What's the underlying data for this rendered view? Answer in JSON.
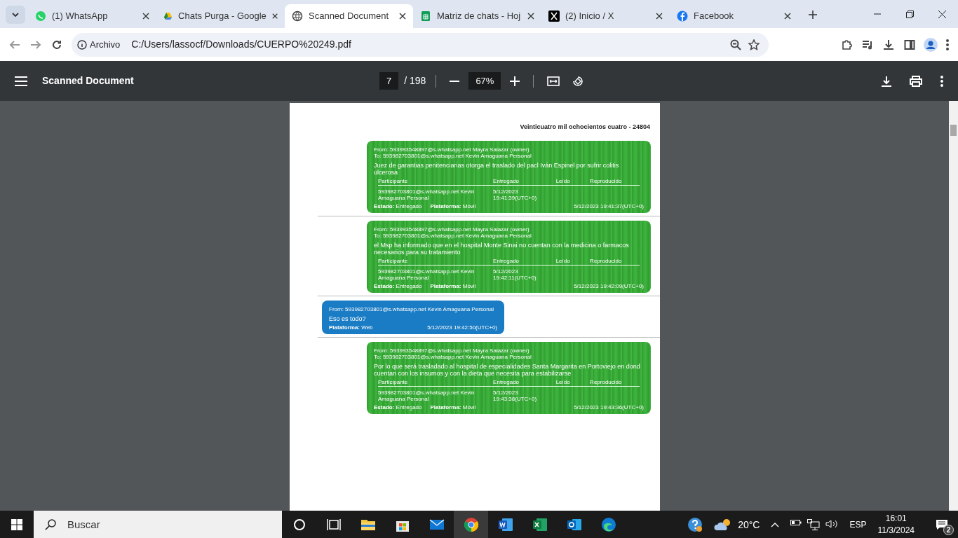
{
  "browser": {
    "tabs": [
      {
        "title": "(1) WhatsApp",
        "selected": false
      },
      {
        "title": "Chats Purga - Google",
        "selected": false
      },
      {
        "title": "Scanned Document",
        "selected": true
      },
      {
        "title": "Matriz de chats - Hoj",
        "selected": false
      },
      {
        "title": "(2) Inicio / X",
        "selected": false
      },
      {
        "title": "Facebook",
        "selected": false
      }
    ],
    "address": {
      "chip": "Archivo",
      "url": "C:/Users/lassocf/Downloads/CUERPO%20249.pdf"
    }
  },
  "pdf_toolbar": {
    "title": "Scanned Document",
    "page": "7",
    "page_total": "/ 198",
    "zoom": "67%"
  },
  "document": {
    "header": "Veinticuatro mil ochocientos cuatro - 24804",
    "messages": [
      {
        "kind": "received",
        "from": "From: 593993548897@s.whatsapp.net Mayra Salazar (owner)",
        "to": "To: 593982703801@s.whatsapp.net Kevin Amaguana Personal",
        "body": "Juez de garantias penitenciarias otorga el traslado del pacl Iván Espinel por sufrir colitis ulcerosa",
        "columns": [
          "Participante",
          "Entregado",
          "Leído",
          "Reproducido"
        ],
        "row": [
          "593982703801@s.whatsapp.net Kevin Amaguana Personal",
          "5/12/2023 19:41:39(UTC+0)"
        ],
        "status": "**Estado:** Entregado",
        "platform": "**Plataforma:** Móvil",
        "timestamp": "5/12/2023 19:41:37(UTC+0)"
      },
      {
        "kind": "received",
        "from": "From: 593993548897@s.whatsapp.net Mayra Salazar (owner)",
        "to": "To: 593982703801@s.whatsapp.net Kevin Amaguana Personal",
        "body": "el Msp ha informado que en el hospital Monte Sinai no cuentan con la medicina o farmacos necesarios para su tratamiento",
        "columns": [
          "Participante",
          "Entregado",
          "Leído",
          "Reproducido"
        ],
        "row": [
          "593982703801@s.whatsapp.net Kevin Amaguana Personal",
          "5/12/2023 19:42:11(UTC+0)"
        ],
        "status": "**Estado:** Entregado",
        "platform": "**Plataforma:** Móvil",
        "timestamp": "5/12/2023 19:42:09(UTC+0)"
      },
      {
        "kind": "sent",
        "from": "From: 593982703801@s.whatsapp.net Kevin Amaguana Personal",
        "body": "Eso es todo?",
        "platform": "**Plataforma:** Web",
        "timestamp": "5/12/2023 19:42:50(UTC+0)"
      },
      {
        "kind": "received",
        "from": "From: 593993548897@s.whatsapp.net Mayra Salazar (owner)",
        "to": "To: 593982703801@s.whatsapp.net Kevin Amaguana Personal",
        "body": "Por lo que será trasladado al hospital de especialidades Santa Margarita en Portoviejo en dond cuentan con los insumos y con la dieta que necesita para estabilizarse",
        "columns": [
          "Participante",
          "Entregado",
          "Leído",
          "Reproducido"
        ],
        "row": [
          "593982703801@s.whatsapp.net Kevin Amaguana Personal",
          "5/12/2023 19:43:38(UTC+0)"
        ],
        "status": "**Estado:** Entregado",
        "platform": "**Plataforma:** Móvil",
        "timestamp": "5/12/2023 19:43:36(UTC+0)"
      }
    ]
  },
  "taskbar": {
    "search_placeholder": "Buscar",
    "temperature": "20°C",
    "language": "ESP",
    "time": "16:01",
    "date": "11/3/2024",
    "notifications": "2"
  }
}
